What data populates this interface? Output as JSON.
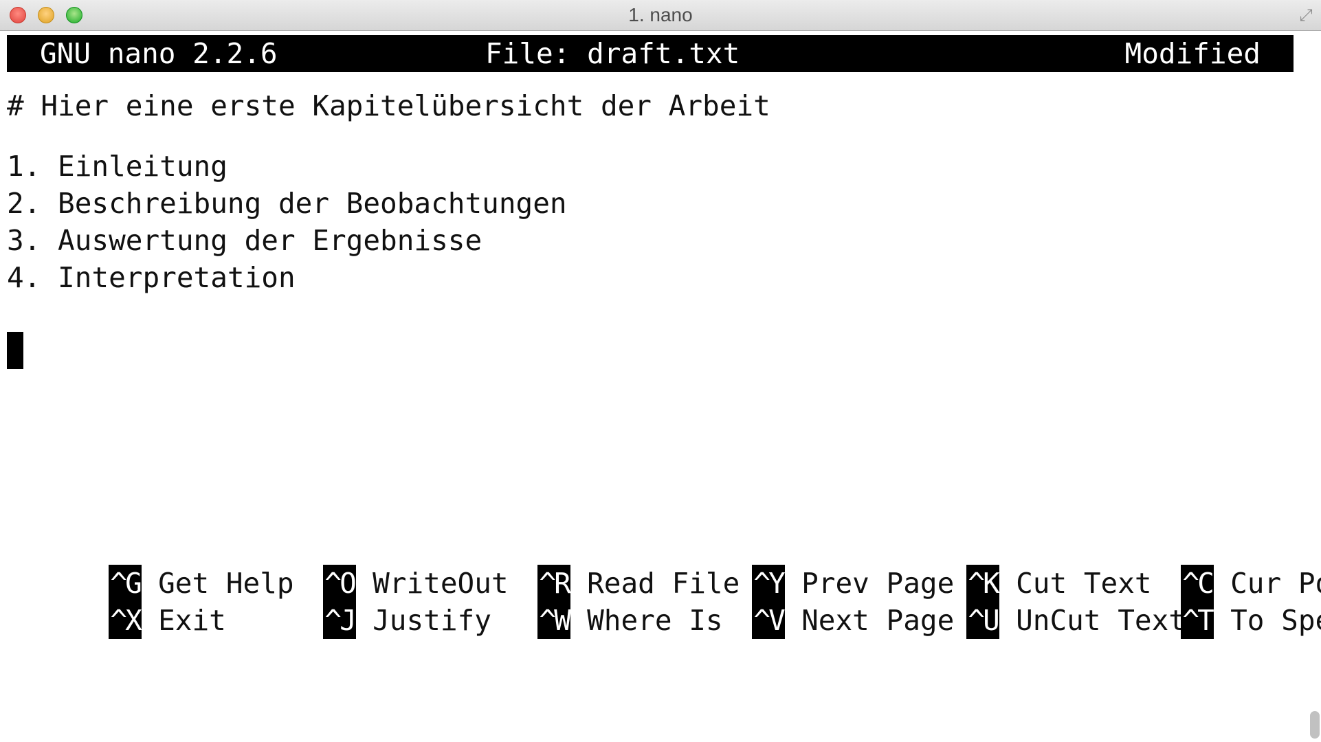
{
  "window": {
    "title": "1. nano"
  },
  "header": {
    "app": "GNU nano 2.2.6",
    "file": "File: draft.txt",
    "status": "Modified"
  },
  "document": {
    "lines": [
      "# Hier eine erste Kapitelübersicht der Arbeit",
      "",
      "1. Einleitung",
      "2. Beschreibung der Beobachtungen",
      "3. Auswertung der Ergebnisse",
      "4. Interpretation"
    ]
  },
  "shortcuts": [
    {
      "key": "^G",
      "label": "Get Help"
    },
    {
      "key": "^O",
      "label": "WriteOut"
    },
    {
      "key": "^R",
      "label": "Read File"
    },
    {
      "key": "^Y",
      "label": "Prev Page"
    },
    {
      "key": "^K",
      "label": "Cut Text"
    },
    {
      "key": "^C",
      "label": "Cur Pos"
    },
    {
      "key": "^X",
      "label": "Exit"
    },
    {
      "key": "^J",
      "label": "Justify"
    },
    {
      "key": "^W",
      "label": "Where Is"
    },
    {
      "key": "^V",
      "label": "Next Page"
    },
    {
      "key": "^U",
      "label": "UnCut Text"
    },
    {
      "key": "^T",
      "label": "To Spell"
    }
  ],
  "icons": {
    "close": "close-window-icon",
    "minimize": "minimize-window-icon",
    "zoom": "zoom-window-icon",
    "fullscreen": "fullscreen-icon"
  }
}
